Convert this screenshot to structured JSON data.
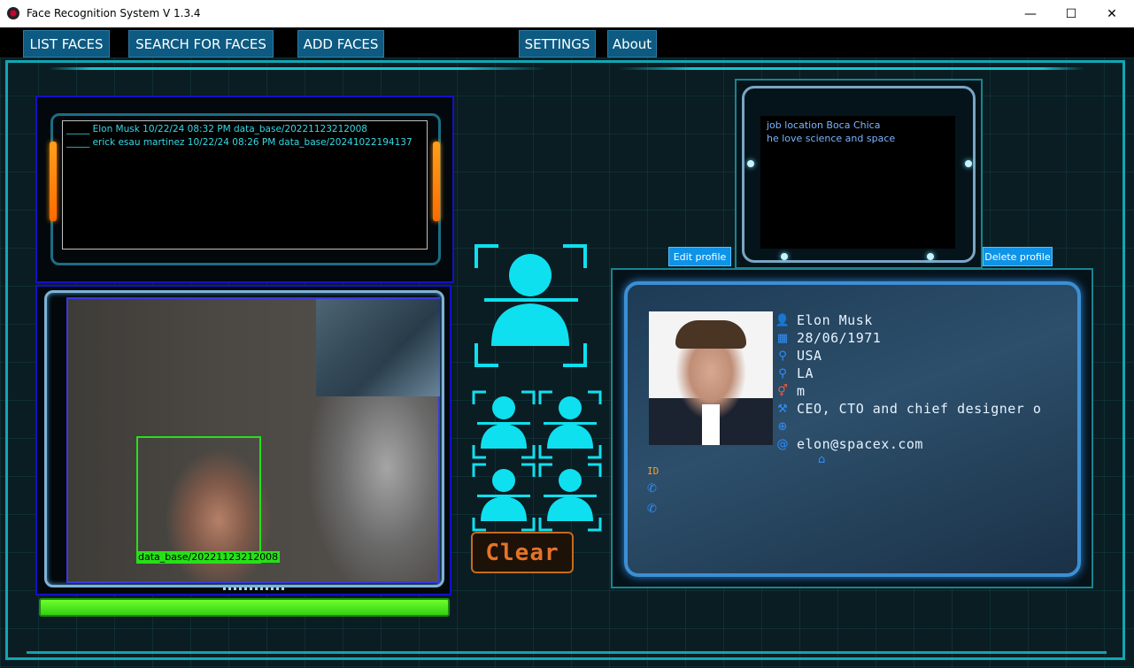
{
  "window": {
    "title": "Face Recognition System V 1.3.4",
    "minimize": "—",
    "maximize": "☐",
    "close": "✕"
  },
  "menu": {
    "list_faces": "LIST FACES",
    "search_faces": "SEARCH FOR FACES",
    "add_faces": "ADD FACES",
    "settings": "SETTINGS",
    "about": "About"
  },
  "log": {
    "entries": [
      "_____ Elon Musk 10/22/24 08:32 PM data_base/20221123212008",
      "_____ erick esau martinez 10/22/24 08:26 PM data_base/20241022194137"
    ]
  },
  "camera": {
    "face_label": "data_base/20221123212008",
    "progress_percent": 100
  },
  "clear_button": "Clear",
  "notes": {
    "lines": [
      "job location Boca Chica",
      "he love science and space"
    ]
  },
  "profile": {
    "edit_label": "Edit profile",
    "delete_label": "Delete profile",
    "name": "Elon Musk",
    "birthdate": "28/06/1971",
    "country": "USA",
    "city": "LA",
    "gender": "m",
    "occupation": "CEO, CTO and chief designer o",
    "website": "",
    "email": "elon@spacex.com",
    "id_label": "ID"
  },
  "colors": {
    "accent_cyan": "#18c2cf",
    "menu_blue": "#0d5a82",
    "button_blue": "#0d93e8",
    "face_box": "#27e018",
    "clear_orange": "#e3732a"
  }
}
